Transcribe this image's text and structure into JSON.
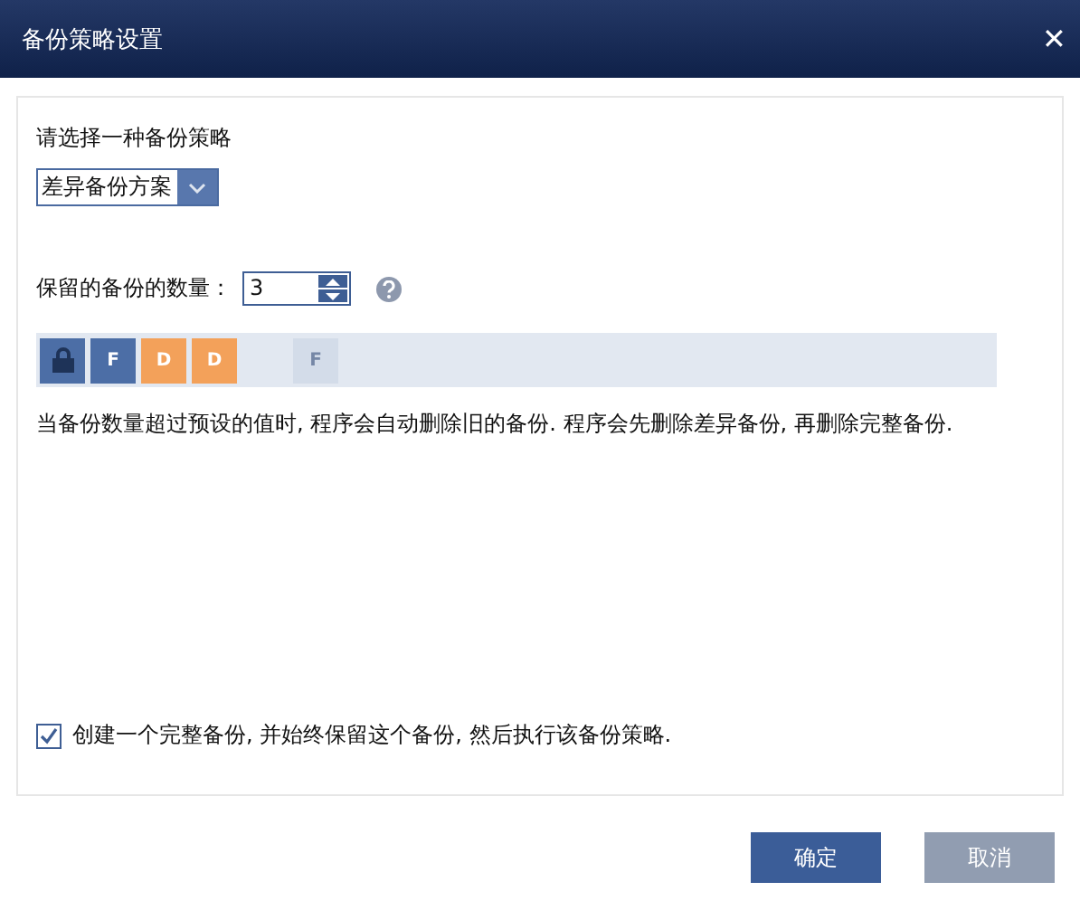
{
  "window": {
    "title": "备份策略设置",
    "close": "✕"
  },
  "strategy": {
    "label": "请选择一种备份策略",
    "value": "差异备份方案"
  },
  "count": {
    "label": "保留的备份的数量：",
    "value": "3"
  },
  "blocks": [
    {
      "kind": "lock"
    },
    {
      "kind": "full",
      "label": "F",
      "faded": false
    },
    {
      "kind": "diff",
      "label": "D",
      "faded": false
    },
    {
      "kind": "diff",
      "label": "D",
      "faded": false
    },
    {
      "kind": "gap"
    },
    {
      "kind": "full",
      "label": "F",
      "faded": true
    }
  ],
  "description": "当备份数量超过预设的值时, 程序会自动删除旧的备份. 程序会先删除差异备份, 再删除完整备份.",
  "keep_full": {
    "label": "创建一个完整备份, 并始终保留这个备份, 然后执行该备份策略.",
    "checked": true
  },
  "buttons": [
    {
      "label": "确定",
      "kind": "primary"
    },
    {
      "label": "取消",
      "kind": "secondary"
    }
  ]
}
